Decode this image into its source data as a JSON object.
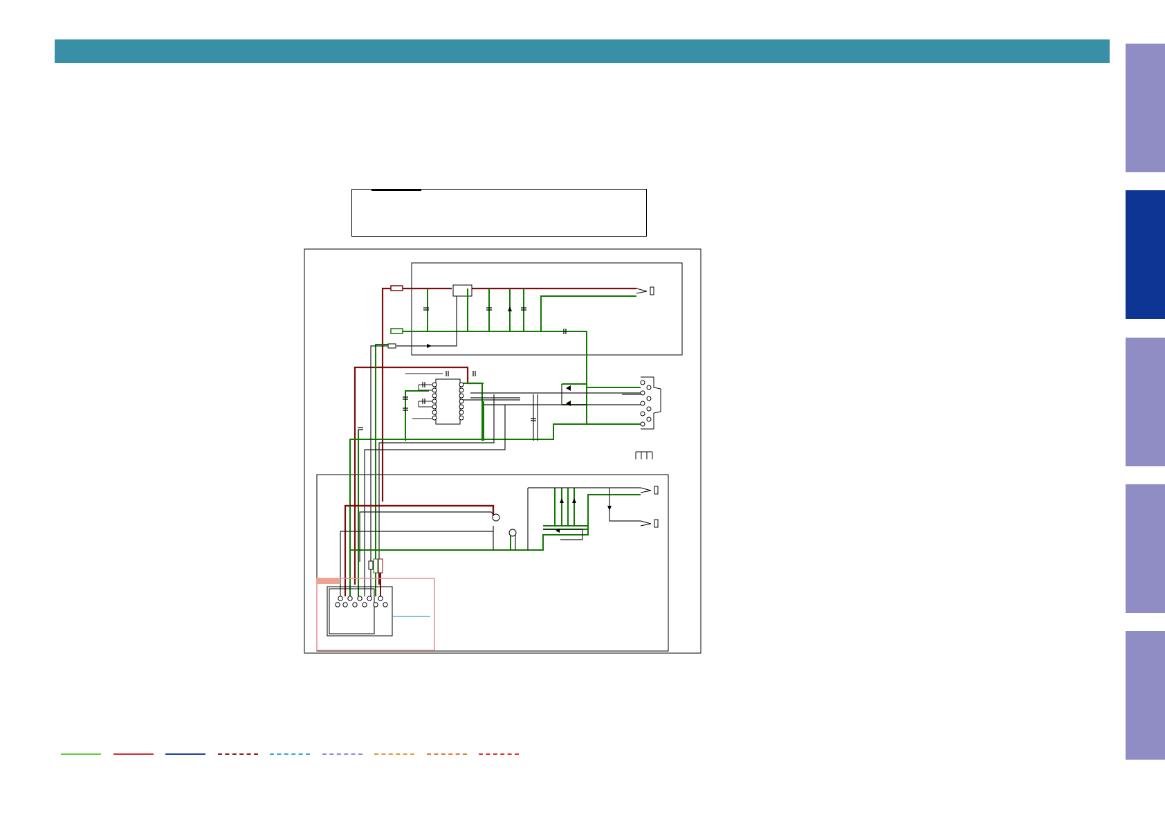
{
  "header": {
    "title": ""
  },
  "side_tabs": [
    {
      "label": "",
      "active": false,
      "color": "#8f8dc3"
    },
    {
      "label": "",
      "active": true,
      "color": "#0e3593"
    },
    {
      "label": "",
      "active": false,
      "color": "#8f8dc3"
    },
    {
      "label": "",
      "active": false,
      "color": "#8f8dc3"
    },
    {
      "label": "",
      "active": false,
      "color": "#8f8dc3"
    }
  ],
  "caption": {
    "text": ""
  },
  "schematic": {
    "wire_colors": {
      "ground": "#107800",
      "power": "#7d0c0c",
      "signal": "#1a1a1a",
      "accent": "#2fa6c2",
      "highlight": "#e58f8f"
    }
  },
  "legend": [
    {
      "style": "solid",
      "color": "#5fd13a",
      "label": ""
    },
    {
      "style": "solid",
      "color": "#d42b2b",
      "label": ""
    },
    {
      "style": "solid",
      "color": "#1c3fa8",
      "label": ""
    },
    {
      "style": "dashed",
      "color": "#8a1b1b",
      "label": ""
    },
    {
      "style": "dashed",
      "color": "#2fa6e0",
      "label": ""
    },
    {
      "style": "dashed",
      "color": "#8f87e8",
      "label": ""
    },
    {
      "style": "dashed",
      "color": "#e09a2f",
      "label": ""
    },
    {
      "style": "dashed",
      "color": "#e0782f",
      "label": ""
    },
    {
      "style": "dashed",
      "color": "#e03030",
      "label": ""
    }
  ]
}
